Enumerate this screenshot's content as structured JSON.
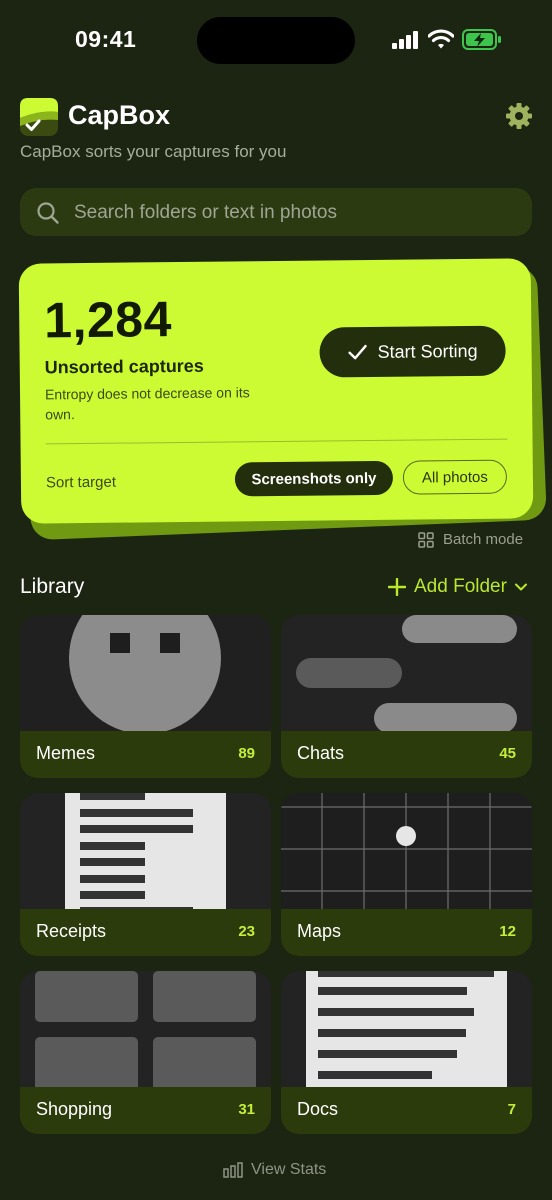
{
  "status": {
    "time": "09:41"
  },
  "header": {
    "app_name": "CapBox",
    "subtitle": "CapBox sorts your captures for you",
    "settings_icon": "gear-icon"
  },
  "search": {
    "placeholder": "Search folders or text in photos"
  },
  "hero": {
    "count": "1,284",
    "count_label": "Unsorted captures",
    "count_sub": "Entropy does not decrease on its own.",
    "start_label": "Start Sorting",
    "sort_target_label": "Sort target",
    "options": [
      "Screenshots only",
      "All photos"
    ],
    "selected_option": "Screenshots only"
  },
  "batch_mode_label": "Batch mode",
  "library": {
    "title": "Library",
    "add_label": "Add Folder",
    "folders": [
      {
        "name": "Memes",
        "count": "89"
      },
      {
        "name": "Chats",
        "count": "45"
      },
      {
        "name": "Receipts",
        "count": "23"
      },
      {
        "name": "Maps",
        "count": "12"
      },
      {
        "name": "Shopping",
        "count": "31"
      },
      {
        "name": "Docs",
        "count": "7"
      }
    ]
  },
  "footer": {
    "view_stats_label": "View Stats"
  },
  "colors": {
    "accent": "#ccfb33",
    "background": "#1c2412",
    "folder_bar": "#2c3b0c"
  }
}
